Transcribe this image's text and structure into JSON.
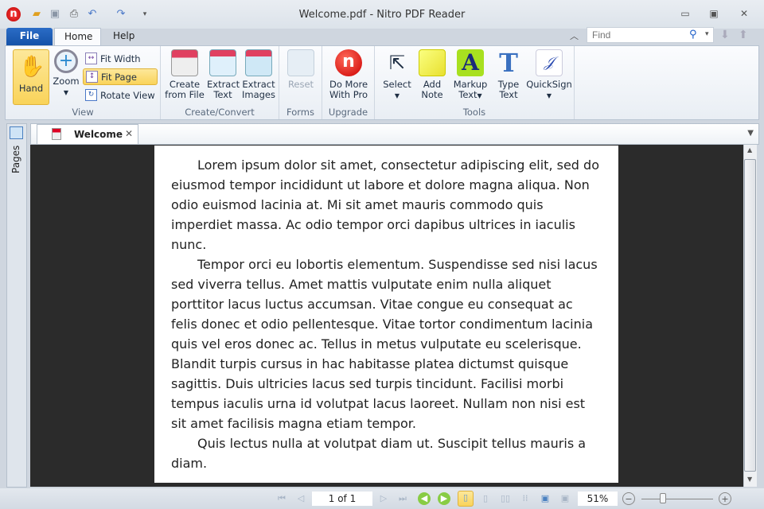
{
  "window": {
    "title": "Welcome.pdf - Nitro PDF Reader"
  },
  "ribbon_tabs": [
    "File",
    "Home",
    "Help"
  ],
  "find": {
    "placeholder": "Find"
  },
  "groups": {
    "view": {
      "label": "View",
      "hand": "Hand",
      "zoom": "Zoom",
      "fit_width": "Fit Width",
      "fit_page": "Fit Page",
      "rotate_view": "Rotate View"
    },
    "create": {
      "label": "Create/Convert",
      "create_from_file": [
        "Create",
        "from File"
      ],
      "extract_text": [
        "Extract",
        "Text"
      ],
      "extract_images": [
        "Extract",
        "Images"
      ]
    },
    "forms": {
      "label": "Forms",
      "reset": "Reset"
    },
    "upgrade": {
      "label": "Upgrade",
      "do_more": [
        "Do More",
        "With Pro"
      ]
    },
    "tools": {
      "label": "Tools",
      "select": "Select",
      "add_note": [
        "Add",
        "Note"
      ],
      "markup_text": [
        "Markup",
        "Text"
      ],
      "type_text": [
        "Type",
        "Text"
      ],
      "quicksign": "QuickSign"
    }
  },
  "side_panel": {
    "label": "Pages"
  },
  "document_tab": {
    "label": "Welcome"
  },
  "document": {
    "paragraphs": [
      "Lorem ipsum dolor sit amet, consectetur adipiscing elit, sed do eiusmod tempor incididunt ut labore et dolore magna aliqua. Non odio euismod lacinia at. Mi sit amet mauris commodo quis imperdiet massa. Ac odio tempor orci dapibus ultrices in iaculis nunc.",
      "Tempor orci eu lobortis elementum. Suspendisse sed nisi lacus sed viverra tellus. Amet mattis vulputate enim nulla aliquet porttitor lacus luctus accumsan. Vitae congue eu consequat ac felis donec et odio pellentesque. Vitae tortor condimentum lacinia quis vel eros donec ac. Tellus in metus vulputate eu scelerisque. Blandit turpis cursus in hac habitasse platea dictumst quisque sagittis. Duis ultricies lacus sed turpis tincidunt. Facilisi morbi tempus iaculis urna id volutpat lacus laoreet. Nullam non nisi est sit amet facilisis magna etiam tempor.",
      "Quis lectus nulla at volutpat diam ut. Suscipit tellus mauris a diam."
    ]
  },
  "status": {
    "page": "1 of 1",
    "zoom": "51%",
    "zoom_slider_fraction": 0.3
  }
}
